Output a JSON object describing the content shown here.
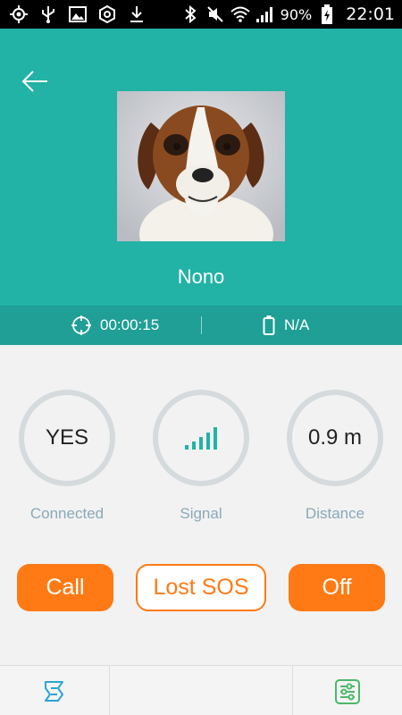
{
  "status_bar": {
    "battery_percent": "90%",
    "time": "22:01",
    "left_icons": [
      "gps-icon",
      "usb-icon",
      "image-icon",
      "hexagon-icon",
      "download-icon"
    ],
    "right_icons": [
      "bluetooth-icon",
      "mute-icon",
      "wifi-icon",
      "signal-icon",
      "battery-charging-icon"
    ]
  },
  "header": {
    "back_icon": "back-arrow-icon",
    "pet_name": "Nono",
    "accent_color": "#22b2a6"
  },
  "info_strip": {
    "timer": "00:00:15",
    "timer_icon": "crosshair-icon",
    "battery": "N/A",
    "battery_icon": "battery-icon"
  },
  "stats": [
    {
      "value": "YES",
      "label": "Connected"
    },
    {
      "value": "",
      "label": "Signal",
      "signal_bars": 5
    },
    {
      "value": "0.9 m",
      "label": "Distance"
    }
  ],
  "actions": {
    "call": "Call",
    "lost_sos": "Lost SOS",
    "off": "Off",
    "accent_color": "#ff7a14"
  },
  "bottom_nav": {
    "left_icon": "map-route-icon",
    "right_icon": "settings-sliders-icon"
  }
}
